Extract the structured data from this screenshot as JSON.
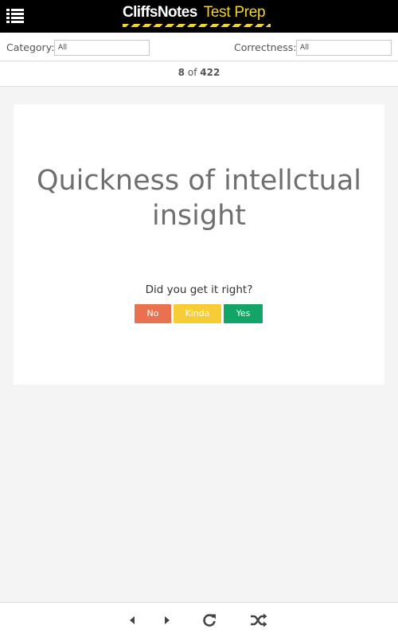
{
  "header": {
    "brand_main": "CliffsNotes",
    "brand_sub": "Test Prep",
    "brand_sub_color": "#f5d328"
  },
  "filters": {
    "category_label": "Category:",
    "category_value": "All",
    "correctness_label": "Correctness:",
    "correctness_value": "All"
  },
  "counter": {
    "current": "8",
    "of_text": "of",
    "total": "422"
  },
  "card": {
    "question": "Quickness of intellctual insight",
    "prompt": "Did you get it right?",
    "buttons": {
      "no": "No",
      "kinda": "Kinda",
      "yes": "Yes"
    },
    "button_colors": {
      "no": "#e8724f",
      "kinda": "#f7cd35",
      "yes": "#13a468"
    }
  },
  "toolbar": {
    "icons": [
      "previous-icon",
      "next-icon",
      "refresh-icon",
      "shuffle-icon"
    ]
  }
}
